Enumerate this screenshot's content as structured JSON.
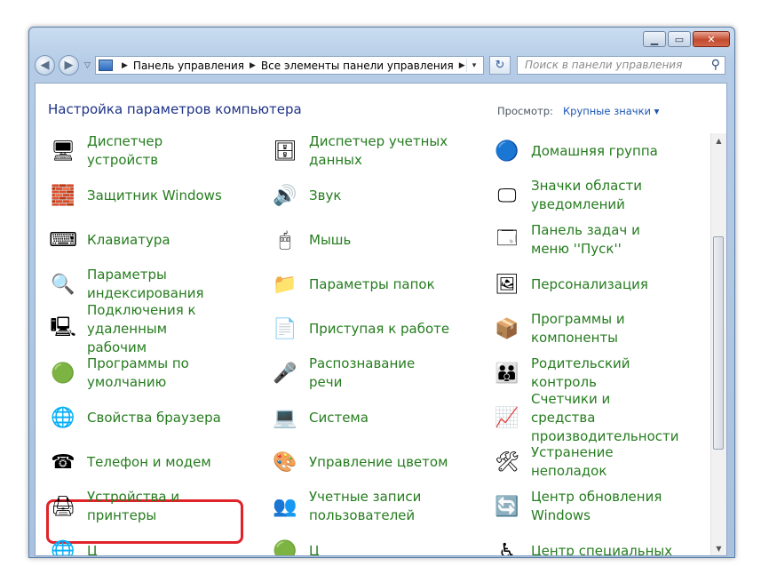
{
  "window": {
    "minimize": "▁",
    "maximize": "▭",
    "close": "✕"
  },
  "nav": {
    "back_icon": "◀",
    "forward_icon": "▶",
    "dropdown": "▽"
  },
  "address": {
    "crumbs": [
      "Панель управления",
      "Все элементы панели управления"
    ],
    "sep": "▶",
    "dropdown": "▾"
  },
  "refresh_icon": "↻",
  "search": {
    "placeholder": "Поиск в панели управления",
    "icon": "⚲"
  },
  "heading": "Настройка параметров компьютера",
  "view": {
    "label": "Просмотр:",
    "value": "Крупные значки ▾"
  },
  "colors": {
    "link": "#257c1e",
    "heading": "#1e3287",
    "highlight": "#e0232b"
  },
  "items": [
    {
      "label": "Диспетчер устройств",
      "icon": "device-manager",
      "glyph": "🖥"
    },
    {
      "label": "Диспетчер учетных данных",
      "icon": "credential-manager",
      "glyph": "🗄"
    },
    {
      "label": "Домашняя группа",
      "icon": "homegroup",
      "glyph": "🔵"
    },
    {
      "label": "Защитник Windows",
      "icon": "windows-defender",
      "glyph": "🧱"
    },
    {
      "label": "Звук",
      "icon": "sound",
      "glyph": "🔊"
    },
    {
      "label": "Значки области уведомлений",
      "icon": "notification-icons",
      "glyph": "🖵"
    },
    {
      "label": "Клавиатура",
      "icon": "keyboard",
      "glyph": "⌨"
    },
    {
      "label": "Мышь",
      "icon": "mouse",
      "glyph": "🖱"
    },
    {
      "label": "Панель задач и меню ''Пуск''",
      "icon": "taskbar",
      "glyph": "🗔"
    },
    {
      "label": "Параметры индексирования",
      "icon": "indexing",
      "glyph": "🔍"
    },
    {
      "label": "Параметры папок",
      "icon": "folder-options",
      "glyph": "📁"
    },
    {
      "label": "Персонализация",
      "icon": "personalization",
      "glyph": "🖼"
    },
    {
      "label": "Подключения к удаленным рабочим",
      "icon": "remote-desktop",
      "glyph": "🖳"
    },
    {
      "label": "Приступая к работе",
      "icon": "getting-started",
      "glyph": "📄"
    },
    {
      "label": "Программы и компоненты",
      "icon": "programs-features",
      "glyph": "📦"
    },
    {
      "label": "Программы по умолчанию",
      "icon": "default-programs",
      "glyph": "🟢"
    },
    {
      "label": "Распознавание речи",
      "icon": "speech-recognition",
      "glyph": "🎤"
    },
    {
      "label": "Родительский контроль",
      "icon": "parental-controls",
      "glyph": "👪"
    },
    {
      "label": "Свойства браузера",
      "icon": "internet-options",
      "glyph": "🌐"
    },
    {
      "label": "Система",
      "icon": "system",
      "glyph": "💻"
    },
    {
      "label": "Счетчики и средства производительности",
      "icon": "performance",
      "glyph": "📈"
    },
    {
      "label": "Телефон и модем",
      "icon": "phone-modem",
      "glyph": "☎"
    },
    {
      "label": "Управление цветом",
      "icon": "color-management",
      "glyph": "🎨"
    },
    {
      "label": "Устранение неполадок",
      "icon": "troubleshooting",
      "glyph": "🛠"
    },
    {
      "label": "Устройства и принтеры",
      "icon": "devices-printers",
      "glyph": "🖨"
    },
    {
      "label": "Учетные записи пользователей",
      "icon": "user-accounts",
      "glyph": "👥"
    },
    {
      "label": "Центр обновления Windows",
      "icon": "windows-update",
      "glyph": "🔄"
    },
    {
      "label": "Ц",
      "icon": "partial-item",
      "glyph": "🌐"
    },
    {
      "label": "Ц",
      "icon": "partial-item",
      "glyph": "🟢"
    },
    {
      "label": "Центр специальных",
      "icon": "ease-of-access",
      "glyph": "♿"
    }
  ],
  "highlighted_item": "Свойства браузера"
}
